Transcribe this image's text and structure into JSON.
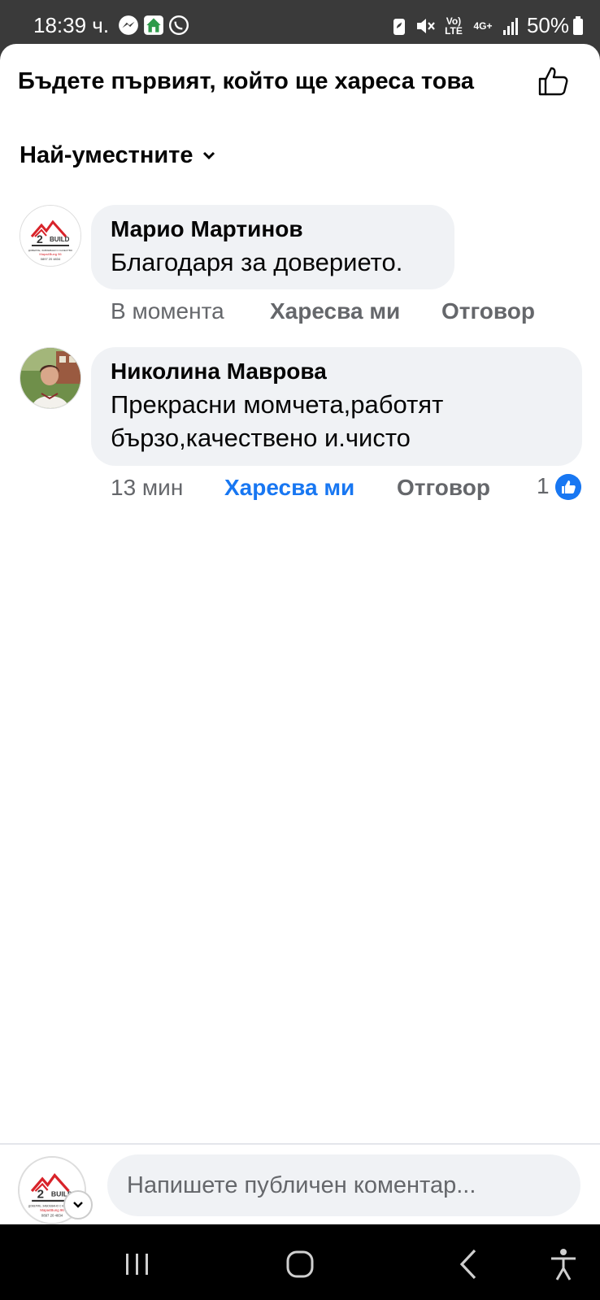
{
  "status_bar": {
    "time": "18:39 ч.",
    "battery": "50%",
    "icons": [
      "messenger-icon",
      "home-icon",
      "viber-icon",
      "battery-saver-icon",
      "mute-icon",
      "volte-icon",
      "4g-icon",
      "signal-icon",
      "battery-icon"
    ],
    "volte_label": "Vo) LTE",
    "network_label": "4G+"
  },
  "header": {
    "title": "Бъдете първият, който ще хареса това"
  },
  "sort": {
    "label": "Най-уместните"
  },
  "comments": [
    {
      "author": "Марио Мартинов",
      "text": "Благодаря за доверието.",
      "time": "В момента",
      "like_label": "Харесва ми",
      "reply_label": "Отговор",
      "liked": false
    },
    {
      "author": "Николина Маврова",
      "text": "Прекрасни момчета,работят бързо,качествено и.чисто",
      "time": "13 мин",
      "like_label": "Харесва ми",
      "reply_label": "Отговор",
      "liked": true,
      "reaction_count": "1"
    }
  ],
  "composer": {
    "placeholder": "Напишете публичен коментар..."
  },
  "logo": {
    "brand": "BUILD",
    "tagline": "ДОВЕРИЕ, ЗАВОЕВАНО С КАЧЕСТВО",
    "handle": "Mapa4Bung 96",
    "phone": "0897 20 4834"
  },
  "colors": {
    "accent": "#1877f2",
    "bubble": "#f0f2f5",
    "secondary_text": "#65676b"
  }
}
